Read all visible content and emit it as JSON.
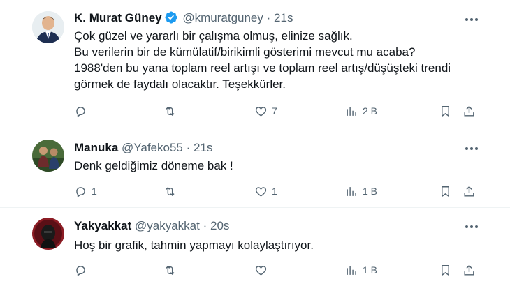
{
  "tweets": [
    {
      "name": "K. Murat Güney",
      "verified": true,
      "handle": "@kmuratguney",
      "separator": "·",
      "time": "21s",
      "lines": [
        "Çok güzel ve yararlı bir çalışma olmuş, elinize sağlık.",
        "Bu verilerin bir de kümülatif/birikimli gösterimi mevcut mu acaba?",
        "1988'den bu yana toplam reel artışı ve toplam reel artış/düşüşteki trendi",
        "görmek de faydalı olacaktır. Teşekkürler."
      ],
      "reply_count": "",
      "retweet_count": "",
      "like_count": "7",
      "view_count": "2 B"
    },
    {
      "name": "Manuka",
      "verified": false,
      "handle": "@Yafeko55",
      "separator": "·",
      "time": "21s",
      "lines": [
        "Denk geldiğimiz döneme bak !"
      ],
      "reply_count": "1",
      "retweet_count": "",
      "like_count": "1",
      "view_count": "1 B"
    },
    {
      "name": "Yakyakkat",
      "verified": false,
      "handle": "@yakyakkat",
      "separator": "·",
      "time": "20s",
      "lines": [
        "Hoş bir grafik, tahmin yapmayı kolaylaştırıyor."
      ],
      "reply_count": "",
      "retweet_count": "",
      "like_count": "",
      "view_count": "1 B"
    }
  ],
  "icons": {
    "reply": "reply-icon",
    "retweet": "retweet-icon",
    "like": "heart-icon",
    "views": "views-icon",
    "bookmark": "bookmark-icon",
    "share": "share-icon",
    "more": "more-icon",
    "verified": "verified-badge-icon"
  },
  "colors": {
    "verified": "#1d9bf0",
    "text": "#0f1419",
    "secondary": "#536471",
    "divider": "#eff3f4"
  }
}
